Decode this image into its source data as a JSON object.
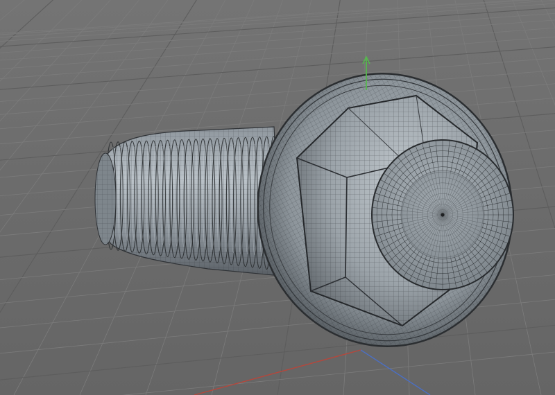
{
  "viewport": {
    "object_name": "hex-flange-bolt-wireframe",
    "grid_visible": true,
    "wireframe_overlay": true
  },
  "colors": {
    "background": "#6c6c6c",
    "grid_minor": "#7b7b7b",
    "grid_major": "#5b5b5b",
    "mesh_surface": "#98a0a7",
    "mesh_dark": "#3c4044",
    "wire": "#232527",
    "axis_x": "#b5473c",
    "axis_y": "#57b84e",
    "axis_z": "#4b6fc4"
  }
}
